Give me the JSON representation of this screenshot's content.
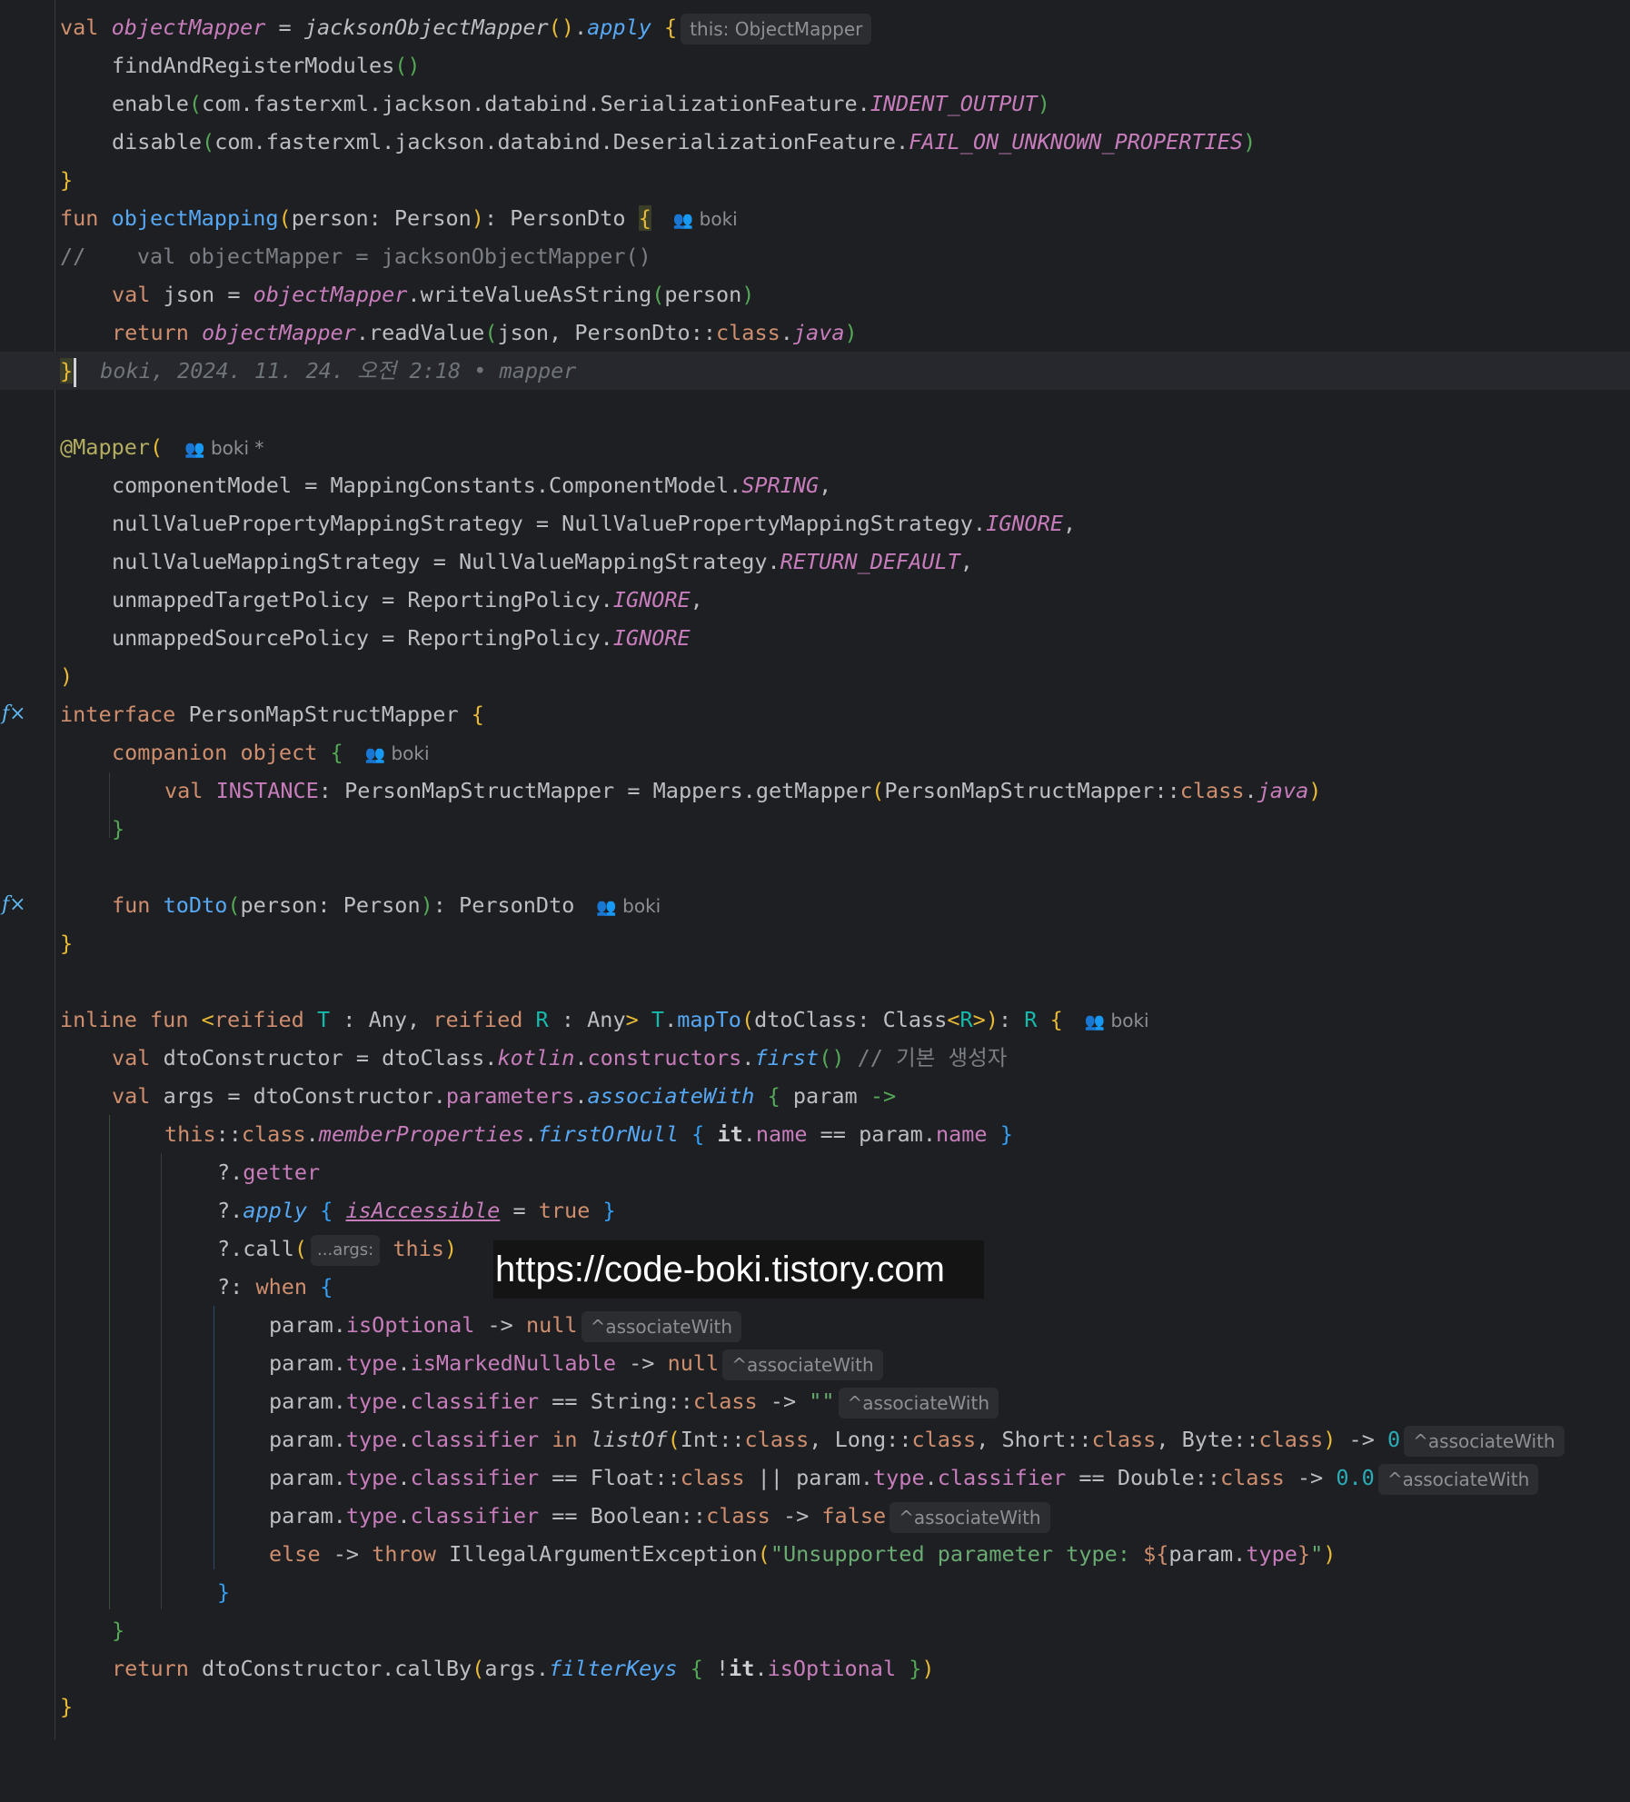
{
  "editor": {
    "inlay_this": "this: ObjectMapper",
    "inlay_args": "...args:",
    "inlay_associate": "^associateWith",
    "author": "boki",
    "author_modified": "boki *",
    "blame": "boki, 2024. 11. 24. 오전 2:18 • mapper",
    "comment_line": "//    val objectMapper = jacksonObjectMapper()",
    "comment_ctor": "// 기본 생성자",
    "error_string": "\"Unsupported parameter type: ",
    "gutter_icon": "implementation-icon"
  },
  "watermark": {
    "text": "https://code-boki.tistory.com"
  },
  "colors": {
    "background": "#1e1f22",
    "keyword": "#cf8e6d",
    "function": "#56a8f5",
    "property": "#c77dbb",
    "string": "#6aab73",
    "number": "#2aacb8",
    "annotation": "#b3ae60",
    "comment": "#7a7e85"
  }
}
